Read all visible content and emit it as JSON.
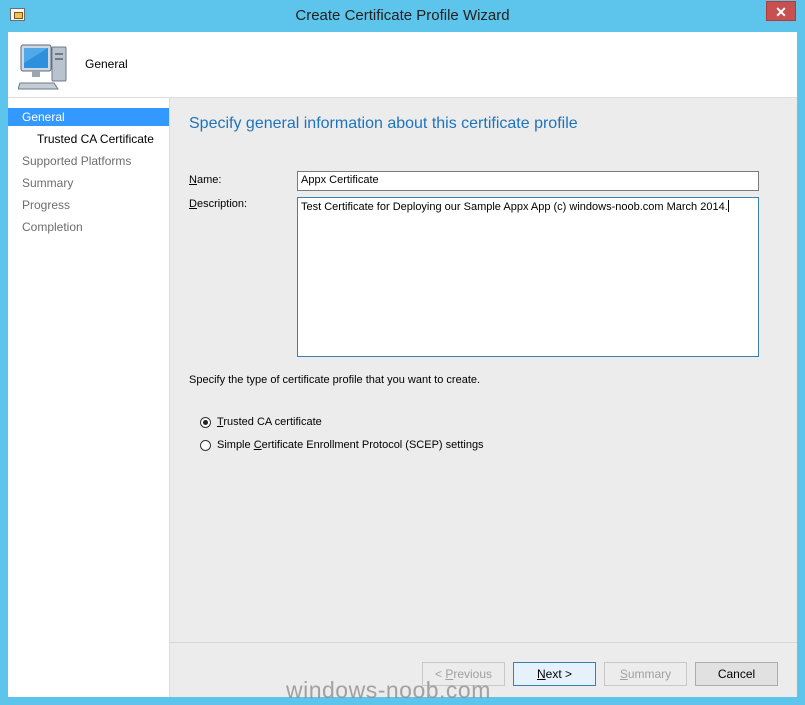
{
  "window": {
    "title": "Create Certificate Profile Wizard",
    "close_label": "✕"
  },
  "header": {
    "title": "General",
    "icon": "computer-icon"
  },
  "nav": {
    "items": [
      {
        "label": "General",
        "state": "active"
      },
      {
        "label": "Trusted CA Certificate",
        "state": "current"
      },
      {
        "label": "Supported Platforms",
        "state": "pending"
      },
      {
        "label": "Summary",
        "state": "pending"
      },
      {
        "label": "Progress",
        "state": "pending"
      },
      {
        "label": "Completion",
        "state": "pending"
      }
    ]
  },
  "main": {
    "heading": "Specify general information about this certificate profile",
    "name_label_access": "N",
    "name_label_rest": "ame:",
    "name_value": "Appx Certificate",
    "description_label_access": "D",
    "description_label_rest": "escription:",
    "description_value": "Test Certificate for Deploying our Sample Appx App (c) windows-noob.com March 2014.",
    "type_prompt": "Specify the type of certificate profile that you want to create.",
    "radio_options": [
      {
        "access": "T",
        "rest": "rusted CA certificate",
        "checked": true
      },
      {
        "before": "Simple ",
        "access": "C",
        "rest": "ertificate Enrollment Protocol (SCEP) settings",
        "checked": false
      }
    ]
  },
  "footer": {
    "previous_access": "P",
    "previous_prefix": "< ",
    "previous_rest": "revious",
    "next_access": "N",
    "next_rest": "ext >",
    "summary_access": "S",
    "summary_rest": "ummary",
    "cancel_label": "Cancel"
  },
  "watermark": "windows-noob.com",
  "colors": {
    "titlebar": "#5dc4eb",
    "accent": "#3399ff",
    "heading": "#1e73be",
    "close": "#c75050"
  }
}
